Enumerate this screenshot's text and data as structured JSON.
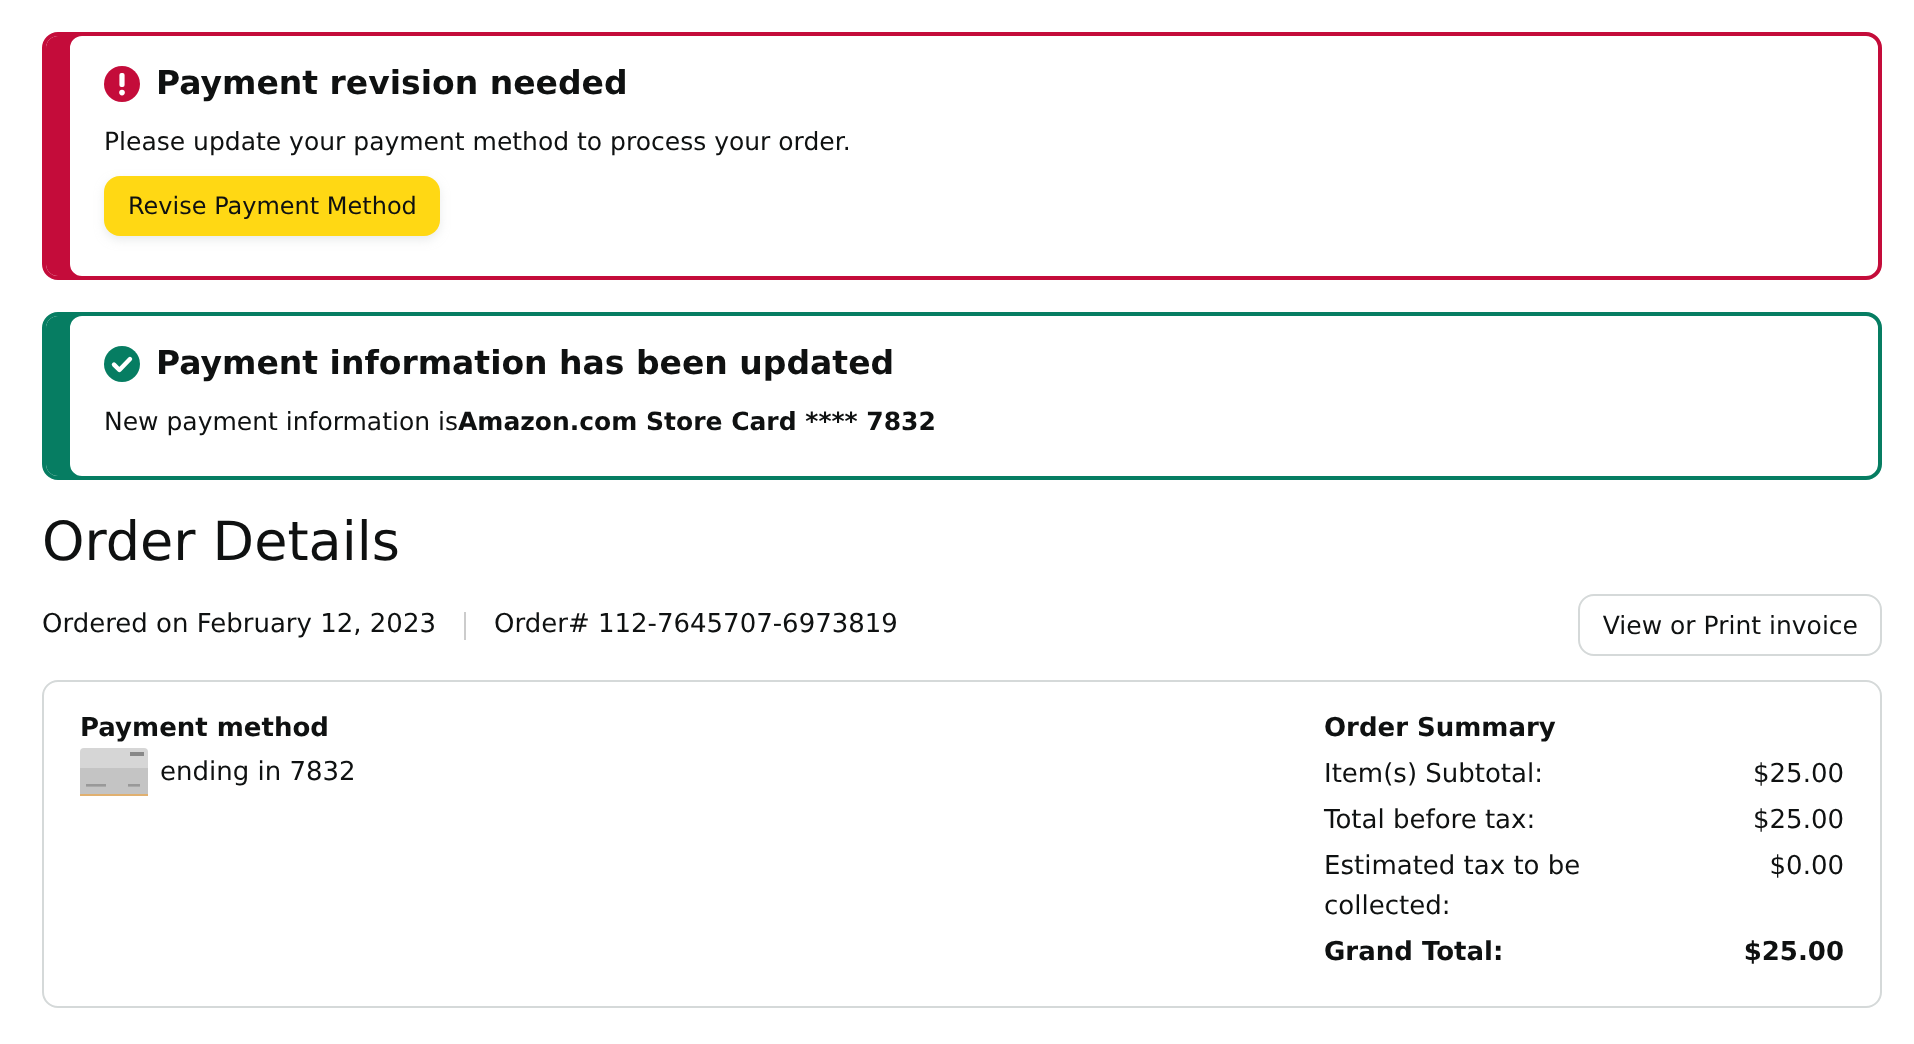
{
  "alerts": [
    {
      "kind": "error",
      "title": "Payment revision needed",
      "message": "Please update your payment method to process your order.",
      "button": "Revise Payment Method"
    },
    {
      "kind": "success",
      "title": "Payment information has been updated",
      "message": "New payment information is",
      "emphasis": "Amazon.com Store Card **** 7832"
    }
  ],
  "order": {
    "heading": "Order Details",
    "ordered_on": "Ordered on February 12, 2023",
    "order_number": "Order# 112-7645707-6973819",
    "invoice_button": "View or Print invoice"
  },
  "payment": {
    "heading": "Payment method",
    "card": "ending in 7832"
  },
  "summary": {
    "heading": "Order Summary",
    "rows": [
      {
        "label": "Item(s) Subtotal:",
        "value": "$25.00",
        "kind": "line"
      },
      {
        "label": "Total before tax:",
        "value": "$25.00",
        "kind": "line"
      },
      {
        "label": "Estimated tax to be collected:",
        "value": "$0.00",
        "kind": "line"
      },
      {
        "label": "Grand Total:",
        "value": "$25.00",
        "kind": "total"
      }
    ]
  }
}
